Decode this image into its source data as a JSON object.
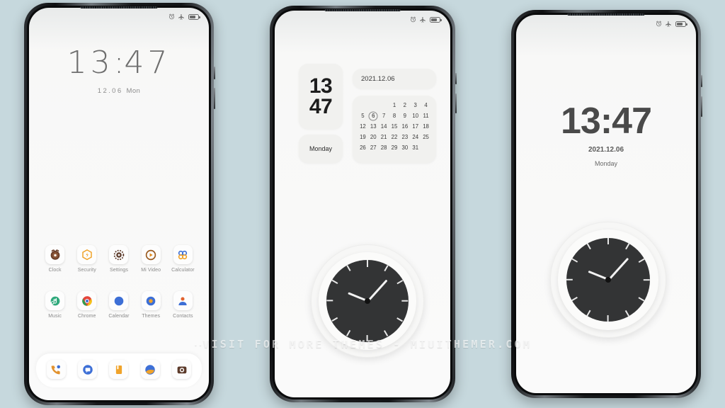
{
  "background_color": "#c6d8dd",
  "watermark": {
    "dots": "··",
    "text": "VISIT FOR MORE THEMES - MIUITHEMER.COM"
  },
  "status_bar": {
    "alarm_icon": "alarm-icon",
    "airplane_icon": "airplane-mode-icon",
    "battery_icon": "battery-icon"
  },
  "phone1": {
    "label": "lockscreen-phone",
    "time": {
      "hours": "13",
      "colon": ":",
      "minutes": "47"
    },
    "date": "12.06",
    "day_of_week": "Mon",
    "apps_row1": [
      {
        "label": "Clock",
        "icon": "clock-app-icon"
      },
      {
        "label": "Security",
        "icon": "security-app-icon"
      },
      {
        "label": "Settings",
        "icon": "settings-app-icon"
      },
      {
        "label": "Mi Video",
        "icon": "mi-video-app-icon"
      },
      {
        "label": "Calculator",
        "icon": "calculator-app-icon"
      }
    ],
    "apps_row2": [
      {
        "label": "Music",
        "icon": "music-app-icon"
      },
      {
        "label": "Chrome",
        "icon": "chrome-app-icon"
      },
      {
        "label": "Calendar",
        "icon": "calendar-app-icon"
      },
      {
        "label": "Themes",
        "icon": "themes-app-icon"
      },
      {
        "label": "Contacts",
        "icon": "contacts-app-icon"
      }
    ],
    "dock": [
      {
        "label": "Phone",
        "icon": "phone-dialer-icon"
      },
      {
        "label": "Messages",
        "icon": "messages-icon"
      },
      {
        "label": "Notes",
        "icon": "notes-icon"
      },
      {
        "label": "Browser",
        "icon": "browser-icon"
      },
      {
        "label": "Camera",
        "icon": "camera-icon"
      }
    ]
  },
  "phone2": {
    "label": "widgets-phone",
    "clock_widget": {
      "hours": "13",
      "minutes": "47"
    },
    "day_widget": "Monday",
    "date_widget": "2021.12.06",
    "calendar": {
      "leading_blanks": 3,
      "days": [
        1,
        2,
        3,
        4,
        5,
        6,
        7,
        8,
        9,
        10,
        11,
        12,
        13,
        14,
        15,
        16,
        17,
        18,
        19,
        20,
        21,
        22,
        23,
        24,
        25,
        26,
        27,
        28,
        29,
        30,
        31
      ],
      "today": 6
    },
    "analog_clock": {
      "icon": "analog-clock-widget",
      "hour_angle": 292,
      "minute_angle": 42,
      "tick_count": 12
    }
  },
  "phone3": {
    "label": "clock-wallpaper-phone",
    "time": "13:47",
    "date": "2021.12.06",
    "day_of_week": "Monday",
    "analog_clock": {
      "icon": "analog-clock-widget",
      "hour_angle": 292,
      "minute_angle": 42,
      "tick_count": 12
    }
  }
}
